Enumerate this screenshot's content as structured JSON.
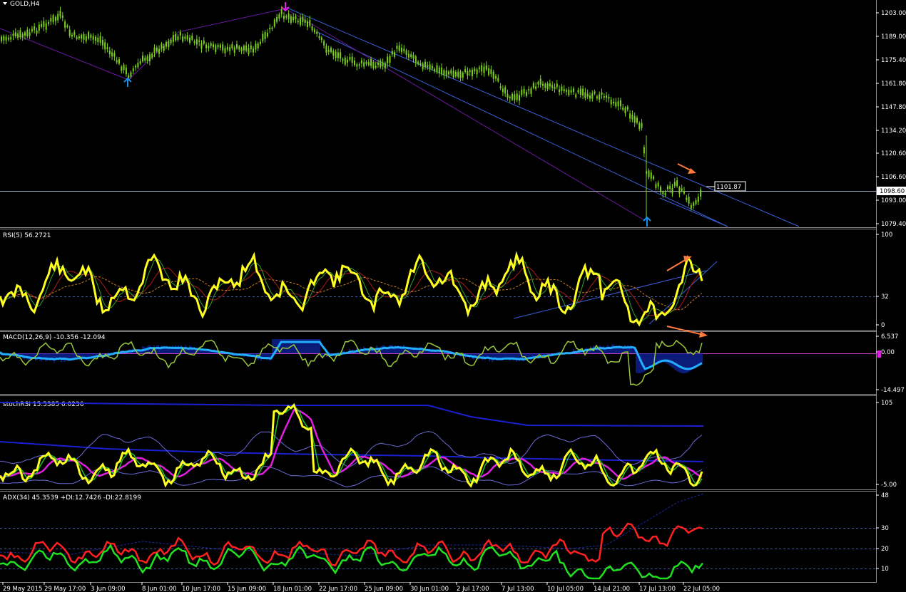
{
  "symbol_title": "GOLD,H4",
  "price_panel": {
    "scale_ticks": [
      "1203.00",
      "1189.00",
      "1175.40",
      "1161.80",
      "1147.80",
      "1134.20",
      "1120.60",
      "1106.60",
      "1093.00",
      "1079.40"
    ],
    "bid_label": "1098.60",
    "box_label": "1101.87"
  },
  "rsi_panel": {
    "title": "RSI(5) 56.2721",
    "scale_ticks": [
      "100",
      "32",
      "0"
    ]
  },
  "macd_panel": {
    "title": "MACD(12,26,9) -10.356 -12.094",
    "scale_ticks": [
      "6.537",
      "0.00",
      "-14.497"
    ]
  },
  "stoch_panel": {
    "title": "stochRSI 15.5385 6.0236",
    "scale_ticks": [
      "105",
      "-5.00"
    ]
  },
  "adx_panel": {
    "title": "ADX(34) 45.3539 +DI:12.7426 -DI:22.8199",
    "scale_ticks": [
      "48",
      "30",
      "20",
      "10"
    ]
  },
  "time_axis": [
    "29 May 2015",
    "29 May 17:00",
    "3 Jun 09:00",
    "8 Jun 01:00",
    "10 Jun 17:00",
    "15 Jun 09:00",
    "18 Jun 01:00",
    "22 Jun 17:00",
    "25 Jun 09:00",
    "30 Jun 01:00",
    "2 Jul 17:00",
    "7 Jul 13:00",
    "10 Jul 05:00",
    "14 Jul 21:00",
    "17 Jul 13:00",
    "22 Jul 05:00"
  ],
  "colors": {
    "candles": "#7cd21a",
    "trendline": "#3a5fd8",
    "diag": "#6a1aa0",
    "arrow_up": "#1a8fe8",
    "arrow_down": "#e020e0",
    "annot": "#ff7a3a",
    "rsi": "#ffff20",
    "macd_hist": "#1030c8",
    "macd_signal": "#20b0ff",
    "stoch_k": "#ffff20",
    "stoch_d": "#e020e0",
    "adx": "#1a2aa0",
    "plus_di": "#20e020",
    "minus_di": "#ff2020"
  }
}
